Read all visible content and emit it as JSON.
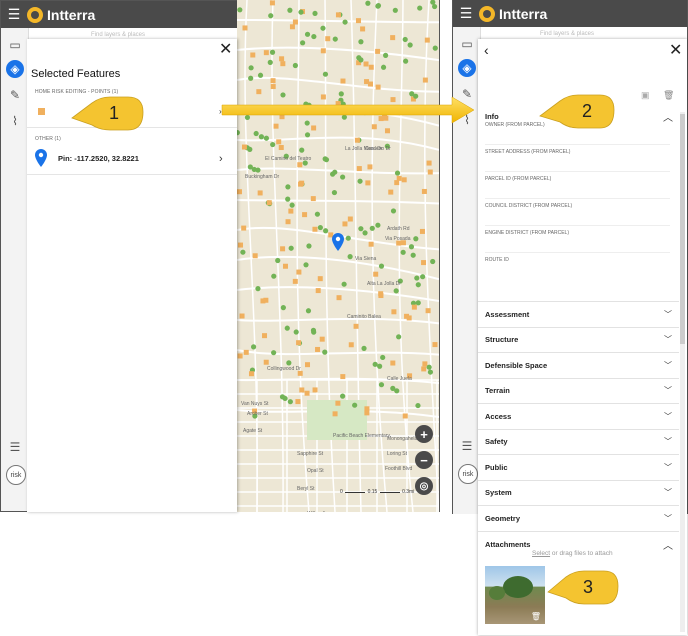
{
  "app": {
    "title": "Intterra"
  },
  "search_placeholder": "Find layers & places",
  "rail": {
    "risk_label": "risk"
  },
  "left_panel": {
    "title": "Selected Features",
    "groups": [
      {
        "header": "HOME RISK EDITING - POINTS (1)"
      },
      {
        "header": "OTHER (1)",
        "item": "Pin: -117.2520, 32.8221"
      }
    ]
  },
  "map": {
    "streets": [
      "El Camino del Teatro",
      "Buckingham Dr",
      "La Jolla Mesa Dr",
      "Caminito Balea",
      "Alta La Jolla Dr",
      "Van Nuys St",
      "Archer St",
      "Agate St",
      "Sapphire St",
      "Opal St",
      "Wilbur Ave",
      "Beryl St",
      "Foothill Blvd",
      "Loring St",
      "Pacific Beach Elementary",
      "Cardeno Dr",
      "Via Posada",
      "Via Siena",
      "Calle Juela",
      "Collingwood Dr",
      "Monongahela St",
      "Ardath Rd"
    ],
    "scale": {
      "zero": "0",
      "mid": "0.15",
      "max": "0.3mi"
    },
    "zoom_in": "+",
    "zoom_out": "−"
  },
  "right_panel": {
    "info": {
      "title": "Info",
      "fields": [
        "OWNER (FROM PARCEL)",
        "STREET ADDRESS (FROM PARCEL)",
        "PARCEL ID (FROM PARCEL)",
        "COUNCIL DISTRICT (FROM PARCEL)",
        "ENGINE DISTRICT (FROM PARCEL)",
        "ROUTE ID"
      ]
    },
    "sections": [
      "Assessment",
      "Structure",
      "Defensible Space",
      "Terrain",
      "Access",
      "Safety",
      "Public",
      "System",
      "Geometry"
    ],
    "attachments": {
      "title": "Attachments",
      "select_link": "Select",
      "hint_rest": " or drag files to attach"
    }
  },
  "callouts": [
    "1",
    "2",
    "3"
  ],
  "colors": {
    "accent": "#1a73e8",
    "callout": "#f4c430",
    "points": "#f0b05e",
    "greens": "#72b356",
    "topbar": "#4a4a4a"
  }
}
